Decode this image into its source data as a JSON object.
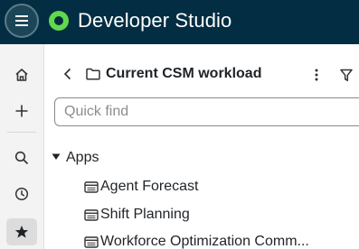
{
  "header": {
    "title": "Developer Studio",
    "menu_icon": "hamburger-menu-icon",
    "logo": "app-logo",
    "background": "#032d42",
    "logo_color": "#62d84e"
  },
  "rail": {
    "items": [
      {
        "name": "home",
        "icon": "home-icon"
      },
      {
        "name": "create",
        "icon": "plus-icon"
      },
      {
        "name": "search",
        "icon": "search-icon"
      },
      {
        "name": "history",
        "icon": "clock-icon"
      },
      {
        "name": "favorites",
        "icon": "star-icon",
        "active": true
      }
    ]
  },
  "panel": {
    "title": "Current CSM workload",
    "back_icon": "chevron-left-icon",
    "folder_icon": "folder-icon",
    "more_icon": "more-vertical-icon",
    "filter_icon": "filter-icon"
  },
  "search": {
    "placeholder": "Quick find",
    "value": ""
  },
  "tree": {
    "group_label": "Apps",
    "expanded": true,
    "items": [
      {
        "label": "Agent Forecast",
        "icon": "app-window-icon"
      },
      {
        "label": "Shift Planning",
        "icon": "app-window-icon"
      },
      {
        "label": "Workforce Optimization Comm...",
        "icon": "app-window-icon"
      }
    ]
  }
}
